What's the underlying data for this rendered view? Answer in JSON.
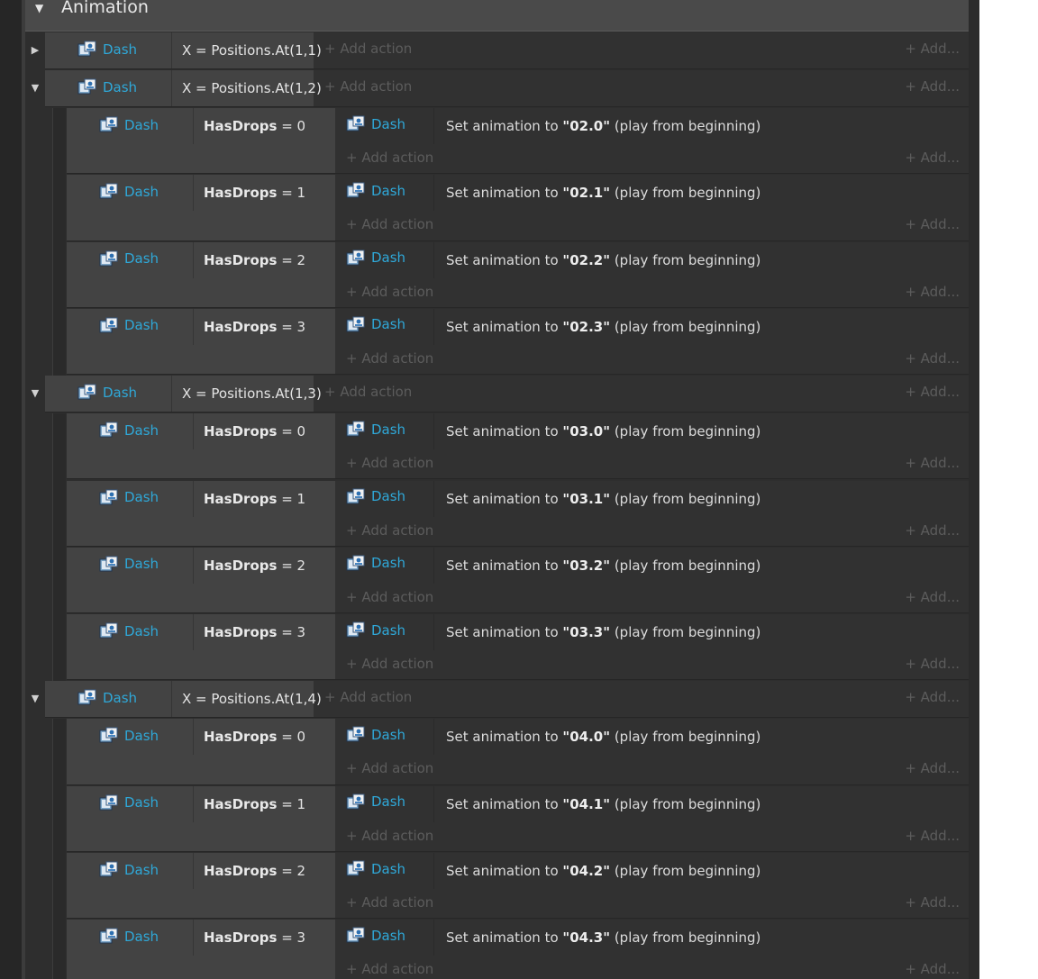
{
  "group": {
    "title": "Animation"
  },
  "labels": {
    "add_action": "Add action",
    "add_more": "Add...",
    "object_name": "Dash"
  },
  "icons": {
    "collapse": "triangle-down",
    "expand": "triangle-right",
    "object": "object-sprite-icon",
    "plus": "plus-icon"
  },
  "colors": {
    "object_link": "#2fa8d8",
    "event_bg": "#313131",
    "condition_bg": "#434343",
    "header_bg": "#4a4a4a"
  },
  "position_events": [
    {
      "condition_var": "X",
      "condition_expr": "Positions.At(1,1)",
      "expanded": false,
      "sub_events": []
    },
    {
      "condition_var": "X",
      "condition_expr": "Positions.At(1,2)",
      "expanded": true,
      "sub_events": [
        {
          "var": "HasDrops",
          "val": "0",
          "anim": "\"02.0\""
        },
        {
          "var": "HasDrops",
          "val": "1",
          "anim": "\"02.1\""
        },
        {
          "var": "HasDrops",
          "val": "2",
          "anim": "\"02.2\""
        },
        {
          "var": "HasDrops",
          "val": "3",
          "anim": "\"02.3\""
        }
      ]
    },
    {
      "condition_var": "X",
      "condition_expr": "Positions.At(1,3)",
      "expanded": true,
      "sub_events": [
        {
          "var": "HasDrops",
          "val": "0",
          "anim": "\"03.0\""
        },
        {
          "var": "HasDrops",
          "val": "1",
          "anim": "\"03.1\""
        },
        {
          "var": "HasDrops",
          "val": "2",
          "anim": "\"03.2\""
        },
        {
          "var": "HasDrops",
          "val": "3",
          "anim": "\"03.3\""
        }
      ]
    },
    {
      "condition_var": "X",
      "condition_expr": "Positions.At(1,4)",
      "expanded": true,
      "sub_events": [
        {
          "var": "HasDrops",
          "val": "0",
          "anim": "\"04.0\""
        },
        {
          "var": "HasDrops",
          "val": "1",
          "anim": "\"04.1\""
        },
        {
          "var": "HasDrops",
          "val": "2",
          "anim": "\"04.2\""
        },
        {
          "var": "HasDrops",
          "val": "3",
          "anim": "\"04.3\""
        }
      ]
    }
  ],
  "action_text": {
    "prefix": "Set animation to",
    "suffix": "(play from beginning)"
  }
}
